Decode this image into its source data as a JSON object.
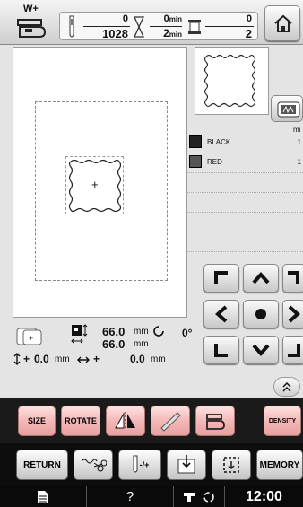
{
  "header": {
    "presser_foot_label": "W+",
    "stitch_count_current": "0",
    "stitch_count_total": "1028",
    "time_current": "0",
    "time_unit": "min",
    "time_total": "2",
    "color_count_current": "0",
    "color_count_total": "2"
  },
  "colors": {
    "list_header": "mi",
    "items": [
      {
        "name": "BLACK",
        "value": "1",
        "swatch": "#222222"
      },
      {
        "name": "RED",
        "value": "1",
        "swatch": "#555555"
      }
    ]
  },
  "info": {
    "height": "66.0",
    "width": "66.0",
    "unit": "mm",
    "angle": "0°",
    "y_offset": "0.0",
    "x_offset": "0.0",
    "plus": "+"
  },
  "edit_toolbar": {
    "size_label": "SIZE",
    "rotate_label": "ROTATE",
    "density_label": "DENSITY"
  },
  "action_toolbar": {
    "return_label": "RETURN",
    "needle_label": "-/+",
    "memory_label": "MEMORY"
  },
  "statusbar": {
    "help_label": "?",
    "clock": "12:00"
  }
}
